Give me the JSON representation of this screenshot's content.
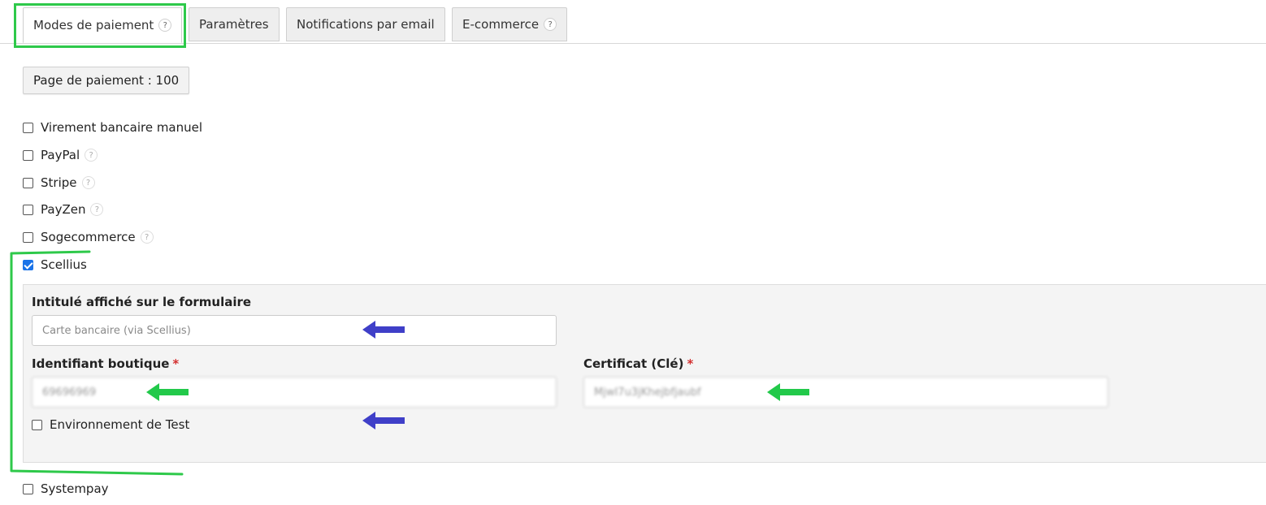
{
  "tabs": [
    {
      "label": "Modes de paiement",
      "has_help": true,
      "active": true
    },
    {
      "label": "Paramètres",
      "has_help": false,
      "active": false
    },
    {
      "label": "Notifications par email",
      "has_help": false,
      "active": false
    },
    {
      "label": "E-commerce",
      "has_help": true,
      "active": false
    }
  ],
  "help_glyph": "?",
  "page_button": {
    "label": "Page de paiement : 100"
  },
  "payment_methods": [
    {
      "label": "Virement bancaire manuel",
      "checked": false,
      "has_help": false
    },
    {
      "label": "PayPal",
      "checked": false,
      "has_help": true
    },
    {
      "label": "Stripe",
      "checked": false,
      "has_help": true
    },
    {
      "label": "PayZen",
      "checked": false,
      "has_help": true
    },
    {
      "label": "Sogecommerce",
      "checked": false,
      "has_help": true
    },
    {
      "label": "Scellius",
      "checked": true,
      "has_help": false
    },
    {
      "label": "Systempay",
      "checked": false,
      "has_help": false
    }
  ],
  "scellius_config": {
    "display_label": {
      "label": "Intitulé affiché sur le formulaire",
      "placeholder": "Carte bancaire (via Scellius)"
    },
    "shop_id": {
      "label": "Identifiant boutique",
      "required_mark": "*",
      "value": "69696969"
    },
    "certificate": {
      "label": "Certificat (Clé)",
      "required_mark": "*",
      "value": "MjwI7u3jKhejbfjaubf"
    },
    "test_env": {
      "label": "Environnement de Test",
      "checked": false
    }
  },
  "colors": {
    "highlight_green": "#2ec94a",
    "arrow_blue": "#3f3fc8",
    "arrow_green": "#22c94a",
    "required_red": "#d32f2f",
    "checkbox_blue": "#1a73e8"
  }
}
